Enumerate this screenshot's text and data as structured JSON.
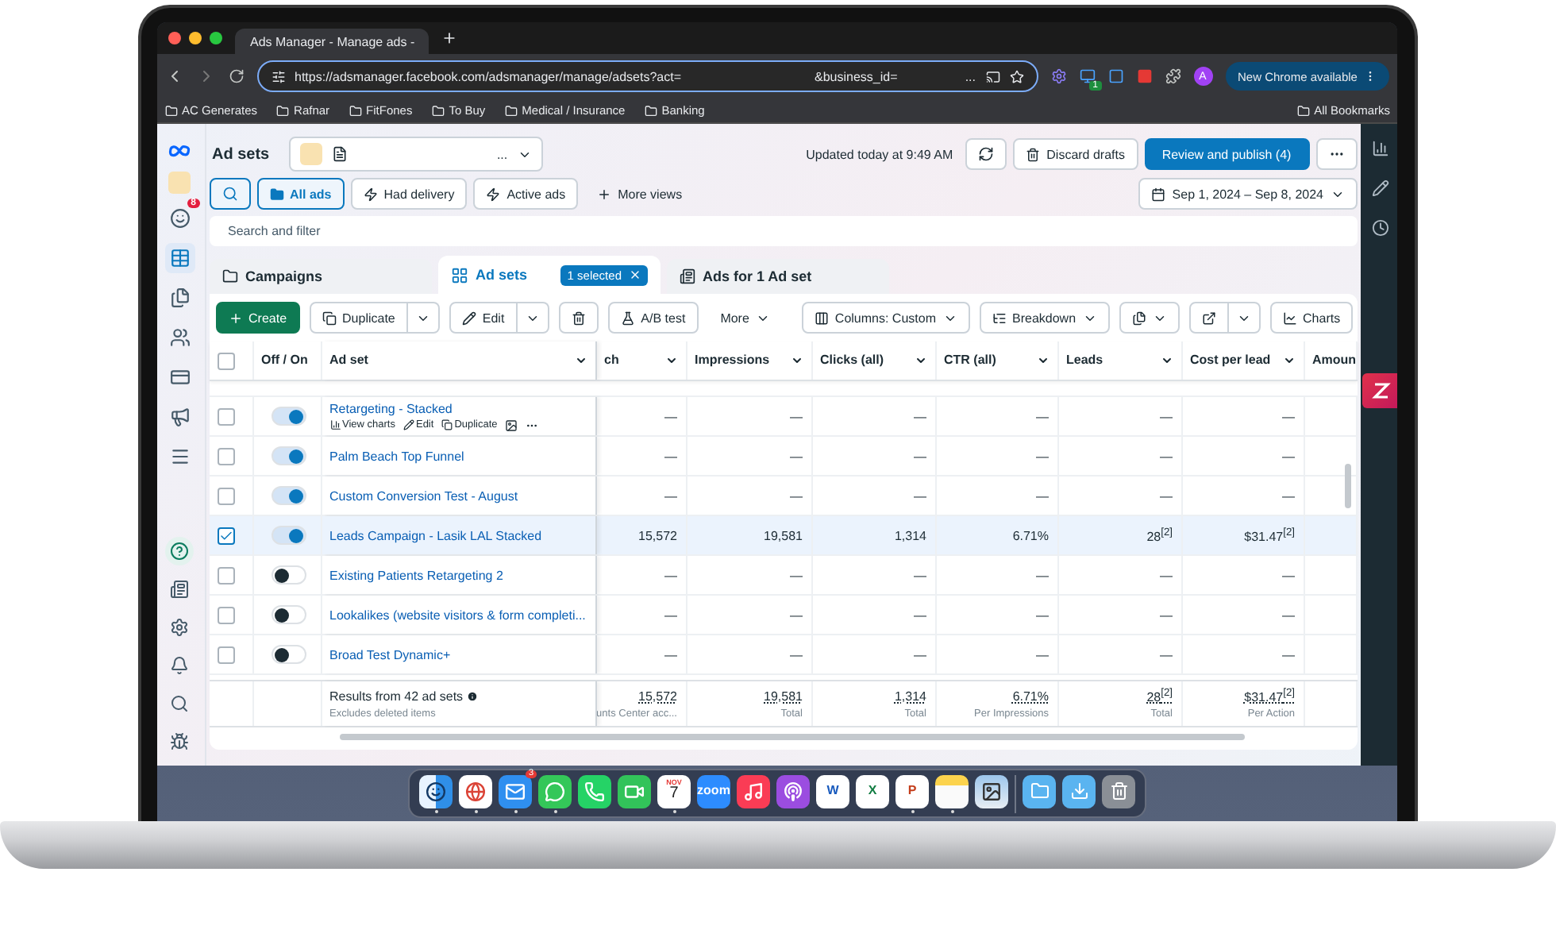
{
  "browser": {
    "tab_title": "Ads Manager - Manage ads -",
    "url": "https://adsmanager.facebook.com/adsmanager/manage/adsets?act=",
    "url_tail": "&business_id=",
    "url_more": "...",
    "extension_badge": "1",
    "profile_initial": "A",
    "update_button": "New Chrome available",
    "bookmarks": [
      "AC Generates",
      "Rafnar",
      "FitFones",
      "To Buy",
      "Medical / Insurance",
      "Banking"
    ],
    "all_bookmarks": "All Bookmarks"
  },
  "sidebar": {
    "notification_count": "8"
  },
  "header": {
    "title": "Ad sets",
    "account_more": "...",
    "updated": "Updated today at 9:49 AM",
    "discard": "Discard drafts",
    "publish": "Review and publish (4)"
  },
  "views": [
    {
      "label": "All ads",
      "selected": true
    },
    {
      "label": "Had delivery",
      "selected": false
    },
    {
      "label": "Active ads",
      "selected": false
    }
  ],
  "more_views": "More views",
  "date_range": "Sep 1, 2024 – Sep 8, 2024",
  "search": {
    "placeholder": "Search and filter"
  },
  "level_tabs": [
    {
      "label": "Campaigns",
      "selected": false
    },
    {
      "label": "Ad sets",
      "selected": true,
      "badge": "1 selected"
    },
    {
      "label": "Ads for 1 Ad set",
      "selected": false
    }
  ],
  "toolbar": {
    "create": "Create",
    "duplicate": "Duplicate",
    "edit": "Edit",
    "ab_test": "A/B test",
    "more": "More",
    "columns": "Columns: Custom",
    "breakdown": "Breakdown",
    "charts": "Charts"
  },
  "table": {
    "select_all": {
      "checked": false
    },
    "columns": [
      "Off / On",
      "Ad set",
      "ch",
      "Impressions",
      "Clicks (all)",
      "CTR (all)",
      "Leads",
      "Cost per lead",
      "Amoun"
    ],
    "rows": [
      {
        "name": "Retargeting - Stacked",
        "on": true,
        "checked": false,
        "actions": [
          "View charts",
          "Edit",
          "Duplicate"
        ],
        "cells": [
          "—",
          "—",
          "—",
          "—",
          "—",
          "—"
        ]
      },
      {
        "name": "Palm Beach Top Funnel",
        "on": true,
        "checked": false,
        "cells": [
          "—",
          "—",
          "—",
          "—",
          "—",
          "—"
        ]
      },
      {
        "name": "Custom Conversion Test - August",
        "on": true,
        "checked": false,
        "cells": [
          "—",
          "—",
          "—",
          "—",
          "—",
          "—"
        ]
      },
      {
        "name": "Leads Campaign - Lasik LAL Stacked",
        "on": true,
        "checked": true,
        "cells": [
          "15,572",
          "19,581",
          "1,314",
          "6.71%",
          "28$^{[2]}$",
          "$31.47$^{[2]}$"
        ]
      },
      {
        "name": "Existing Patients Retargeting 2",
        "on": false,
        "checked": false,
        "cells": [
          "—",
          "—",
          "—",
          "—",
          "—",
          "—"
        ]
      },
      {
        "name": "Lookalikes (website visitors & form completi...",
        "on": false,
        "checked": false,
        "cells": [
          "—",
          "—",
          "—",
          "—",
          "—",
          "—"
        ]
      },
      {
        "name": "Broad Test Dynamic+",
        "on": false,
        "checked": false,
        "cells": [
          "—",
          "—",
          "—",
          "—",
          "—",
          "—"
        ]
      }
    ],
    "footer": {
      "title": "Results from 42 ad sets",
      "note": "Excludes deleted items",
      "cells": [
        {
          "value": "15,572",
          "caption": "unts Center acc..."
        },
        {
          "value": "19,581",
          "caption": "Total"
        },
        {
          "value": "1,314",
          "caption": "Total"
        },
        {
          "value": "6.71%",
          "caption": "Per Impressions"
        },
        {
          "value": "28$^{[2]}$",
          "caption": "Total"
        },
        {
          "value": "$31.47$^{[2]}$",
          "caption": "Per Action"
        }
      ]
    }
  },
  "dock": {
    "apps": [
      {
        "kind": "finder",
        "running": true
      },
      {
        "kind": "chrome",
        "running": true
      },
      {
        "kind": "mail",
        "running": true,
        "badge": "3"
      },
      {
        "kind": "messages",
        "running": true
      },
      {
        "kind": "whatsapp",
        "running": false
      },
      {
        "kind": "facetime",
        "running": false
      },
      {
        "kind": "calendar",
        "running": true,
        "month": "NOV",
        "day": "7"
      },
      {
        "kind": "zoom",
        "running": false,
        "label": "zoom"
      },
      {
        "kind": "music",
        "running": false
      },
      {
        "kind": "podcasts",
        "running": false
      },
      {
        "kind": "word",
        "running": false,
        "label": "W"
      },
      {
        "kind": "excel",
        "running": false,
        "label": "X"
      },
      {
        "kind": "powerpoint",
        "running": true,
        "label": "P"
      },
      {
        "kind": "notes",
        "running": true
      },
      {
        "kind": "preview",
        "running": false
      }
    ],
    "stacks": [
      {
        "kind": "folder"
      },
      {
        "kind": "downloads"
      },
      {
        "kind": "trash"
      }
    ]
  }
}
